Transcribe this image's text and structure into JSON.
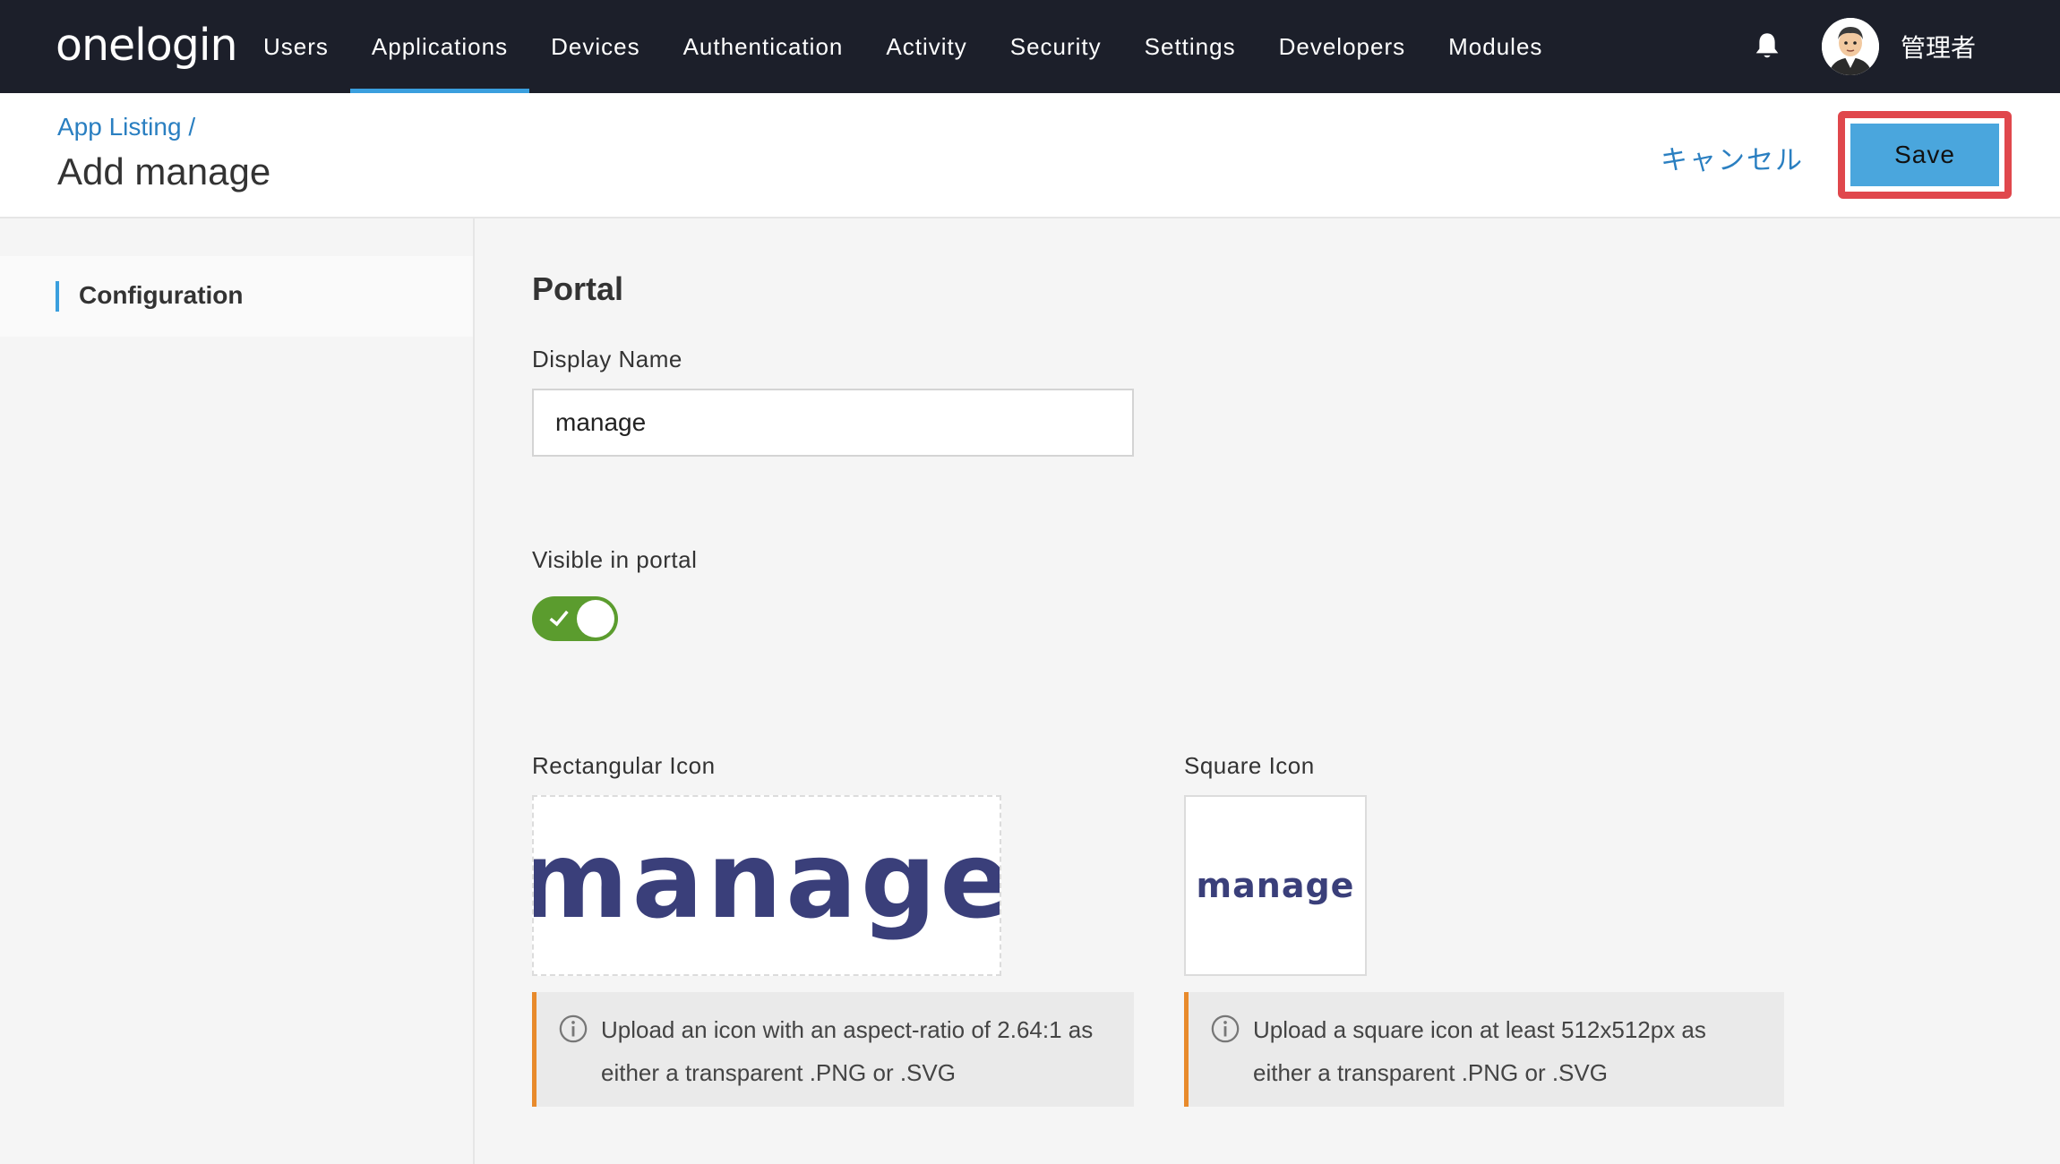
{
  "nav": {
    "logo": "onelogin",
    "items": [
      {
        "label": "Users",
        "active": false
      },
      {
        "label": "Applications",
        "active": true
      },
      {
        "label": "Devices",
        "active": false
      },
      {
        "label": "Authentication",
        "active": false
      },
      {
        "label": "Activity",
        "active": false
      },
      {
        "label": "Security",
        "active": false
      },
      {
        "label": "Settings",
        "active": false
      },
      {
        "label": "Developers",
        "active": false
      },
      {
        "label": "Modules",
        "active": false
      }
    ],
    "user_name": "管理者",
    "bell_icon": "bell-icon",
    "accent_color": "#3a9fde"
  },
  "header": {
    "breadcrumb": "App Listing /",
    "title": "Add manage",
    "cancel_label": "キャンセル",
    "save_label": "Save"
  },
  "sidebar": {
    "items": [
      {
        "label": "Configuration",
        "active": true
      }
    ]
  },
  "main": {
    "section_title": "Portal",
    "display_name_label": "Display Name",
    "display_name_value": "manage",
    "visible_label": "Visible in portal",
    "visible_on": true,
    "rect_icon_label": "Rectangular Icon",
    "rect_icon_text": "manage",
    "square_icon_label": "Square Icon",
    "square_icon_text": "manage",
    "rect_info": "Upload an icon with an aspect-ratio of 2.64:1 as either a transparent .PNG or .SVG",
    "square_info": "Upload a square icon at least 512x512px as either a transparent .PNG or .SVG"
  }
}
